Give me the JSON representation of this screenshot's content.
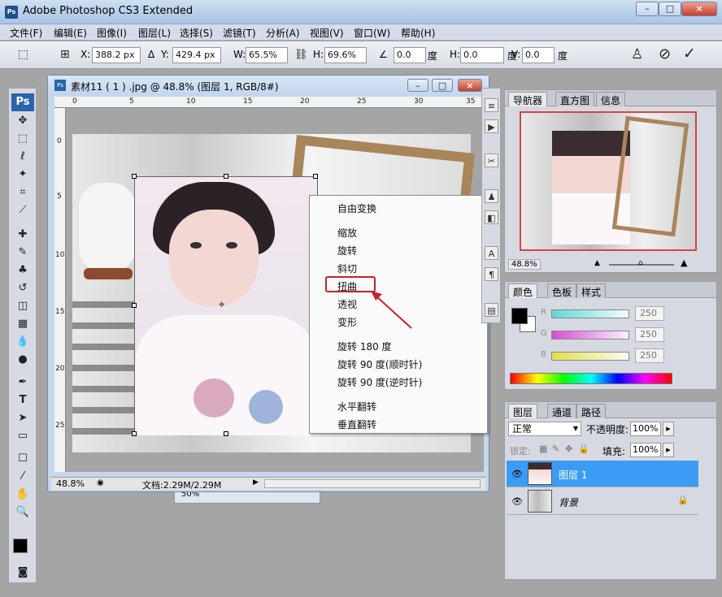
{
  "app": {
    "title": "Adobe Photoshop CS3 Extended",
    "logo": "Ps"
  },
  "window_buttons": {
    "minimize": "–",
    "maximize": "□",
    "close": "×"
  },
  "menu": [
    "文件(F)",
    "编辑(E)",
    "图像(I)",
    "图层(L)",
    "选择(S)",
    "滤镜(T)",
    "分析(A)",
    "视图(V)",
    "窗口(W)",
    "帮助(H)"
  ],
  "options": {
    "x_label": "X:",
    "x_value": "388.2 px",
    "y_label": "Y:",
    "y_value": "429.4 px",
    "w_label": "W:",
    "w_value": "65.5%",
    "h_label": "H:",
    "h_value": "69.6%",
    "angle_value": "0.0",
    "angle_unit": "度",
    "hskew_label": "H:",
    "hskew_value": "0.0",
    "hskew_unit": "度",
    "vskew_label": "V:",
    "vskew_value": "0.0",
    "vskew_unit": "度",
    "cancel_icon": "⊘",
    "commit_icon": "✓"
  },
  "document": {
    "title": "素材11 ( 1 ) .jpg @ 48.8% (图层 1, RGB/8#)",
    "ruler_h": [
      "0",
      "5",
      "10",
      "15",
      "20",
      "25",
      "30",
      "35"
    ],
    "ruler_v": [
      "0",
      "5",
      "10",
      "15",
      "20",
      "25"
    ],
    "zoom": "48.8%",
    "doc_info": "文档:2.29M/2.29M"
  },
  "second_doc_zoom": "50%",
  "context_menu": {
    "items": [
      "自由变换",
      "缩放",
      "旋转",
      "斜切",
      "扭曲",
      "透视",
      "变形",
      "旋转 180 度",
      "旋转 90 度(顺时针)",
      "旋转 90 度(逆时针)",
      "水平翻转",
      "垂直翻转"
    ],
    "highlighted": "扭曲",
    "highlight_color": "#c52328"
  },
  "navigator": {
    "tabs": [
      "导航器",
      "直方图",
      "信息"
    ],
    "zoom": "48.8%"
  },
  "color_panel": {
    "tabs": [
      "颜色",
      "色板",
      "样式"
    ],
    "r_label": "R",
    "r_value": "250",
    "g_label": "G",
    "g_value": "250",
    "b_label": "B",
    "b_value": "250"
  },
  "layers_panel": {
    "tabs": [
      "图层",
      "通道",
      "路径"
    ],
    "blend_mode": "正常",
    "opacity_label": "不透明度:",
    "opacity_value": "100%",
    "lock_label": "锁定:",
    "fill_label": "填充:",
    "fill_value": "100%",
    "layers": [
      {
        "name": "图层 1",
        "selected": true
      },
      {
        "name": "背景",
        "selected": false,
        "locked": true
      }
    ],
    "selected_color": "#3c9cf5"
  }
}
